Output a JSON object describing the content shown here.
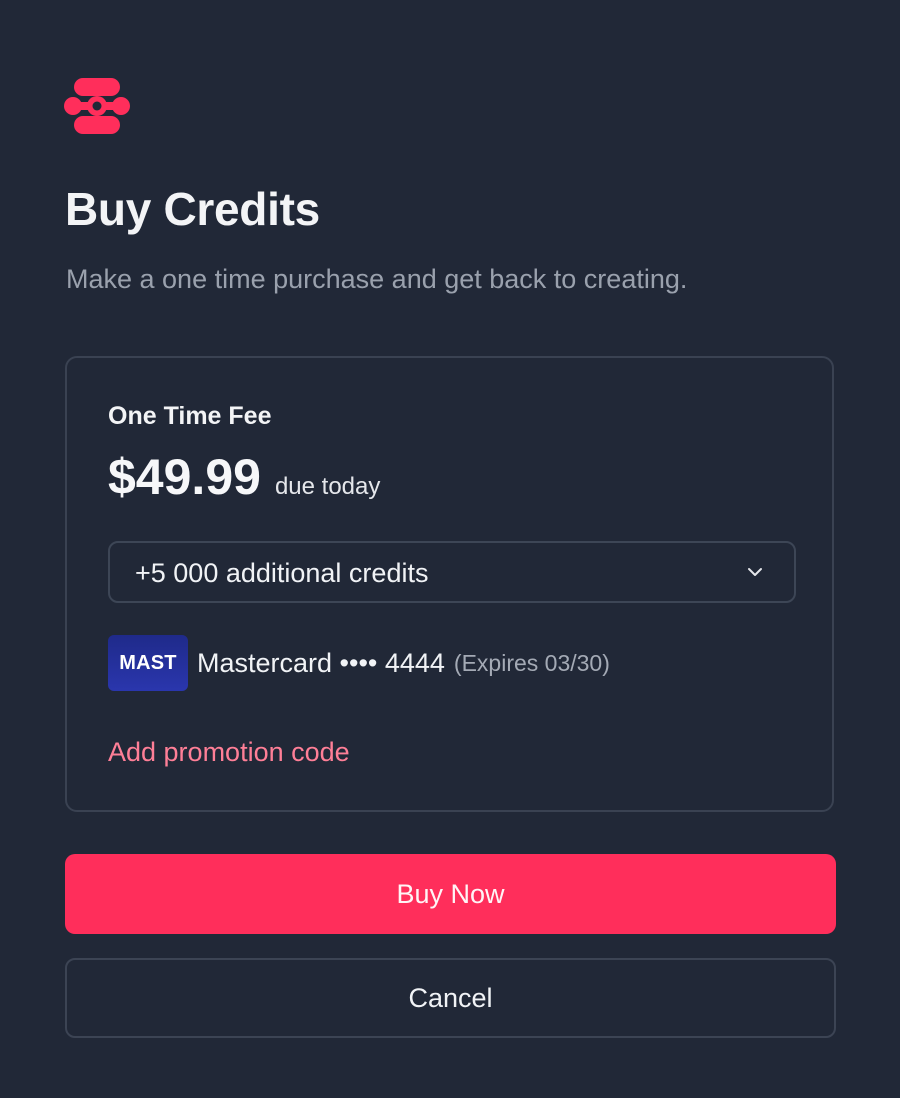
{
  "header": {
    "logo_icon": "linked-nodes-logo-icon",
    "title": "Buy Credits",
    "subtitle": "Make a one time purchase and get back to creating."
  },
  "fee_card": {
    "label": "One Time Fee",
    "price": "$49.99",
    "due_text": "due today",
    "credits_select": {
      "selected": "+5 000 additional credits",
      "icon": "chevron-down-icon"
    },
    "payment_method": {
      "badge": "MAST",
      "name": "Mastercard •••• 4444",
      "expiry": "(Expires 03/30)"
    },
    "promo_link": "Add promotion code"
  },
  "actions": {
    "buy_label": "Buy Now",
    "cancel_label": "Cancel"
  },
  "colors": {
    "background": "#212837",
    "accent": "#ff2e5b",
    "link": "#ff7f97",
    "border": "#3a4252",
    "muted_text": "#9aa1ad"
  }
}
